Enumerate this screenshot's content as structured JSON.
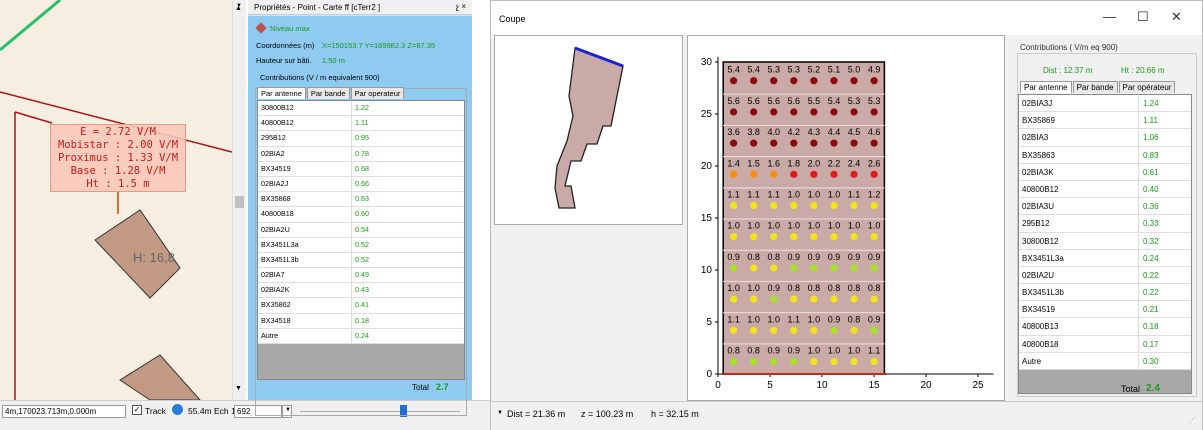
{
  "map": {
    "label_lines": [
      "E = 2.72 V/M",
      "Mobistar : 2.00 V/M",
      "Proximus : 1.33 V/M",
      "Base : 1.28 V/M",
      "Ht : 1.5 m"
    ],
    "building_label": "H: 16,8"
  },
  "map_status": {
    "coords": "4m,170023.713m,0.000m",
    "track_label": "Track",
    "scale_value": "55.4m",
    "ech_label": "Ech 1:",
    "ech_value": "692"
  },
  "props": {
    "title": "Propriétés - Point - Carte ff [cTerr2 ]",
    "pin": "չ ×",
    "niveau_label": "Niveau max",
    "coord_label": "Coordonnées (m)",
    "coord_value": "X=150153.7  Y=169982.3  Z=87.35",
    "hauteur_label": "Hauteur sur bâti.",
    "hauteur_value": "1.50 m",
    "group_title": "Contributions (V / m equivalent 900)",
    "tabs": [
      "Par antenne",
      "Par bande",
      "Par operateur"
    ],
    "rows": [
      {
        "name": "30800B12",
        "value": "1.22"
      },
      {
        "name": "40800B12",
        "value": "1.11"
      },
      {
        "name": "295B12",
        "value": "0.95"
      },
      {
        "name": "02BIA2",
        "value": "0.78"
      },
      {
        "name": "BX34519",
        "value": "0.68"
      },
      {
        "name": "02BIA2J",
        "value": "0.66"
      },
      {
        "name": "BX35868",
        "value": "0.63"
      },
      {
        "name": "40800B18",
        "value": "0.60"
      },
      {
        "name": "02BIA2U",
        "value": "0.54"
      },
      {
        "name": "BX3451L3a",
        "value": "0.52"
      },
      {
        "name": "BX3451L3b",
        "value": "0.52"
      },
      {
        "name": "02BIA7",
        "value": "0.49"
      },
      {
        "name": "02BIA2K",
        "value": "0.43"
      },
      {
        "name": "BX35862",
        "value": "0.41"
      },
      {
        "name": "BX34518",
        "value": "0.18"
      },
      {
        "name": "Autre",
        "value": "0.24"
      }
    ],
    "total_label": "Total",
    "total_value": "2.7"
  },
  "coupe": {
    "title": "Coupe",
    "min_icon": "—",
    "max_icon": "☐",
    "close_icon": "✕",
    "group_title": "Contributions ( V/m eq 900)",
    "dist_text": "Dist : 12.37 m",
    "ht_text": "Ht : 20.66 m",
    "tabs": [
      "Par antenne",
      "Par bande",
      "Par opérateur"
    ],
    "rows": [
      {
        "name": "02BIA3J",
        "value": "1.24"
      },
      {
        "name": "BX35869",
        "value": "1.11"
      },
      {
        "name": "02BIA3",
        "value": "1.06"
      },
      {
        "name": "BX35863",
        "value": "0.83"
      },
      {
        "name": "02BIA3K",
        "value": "0.61"
      },
      {
        "name": "40800B12",
        "value": "0.40"
      },
      {
        "name": "02BIA3U",
        "value": "0.36"
      },
      {
        "name": "295B12",
        "value": "0.33"
      },
      {
        "name": "30800B12",
        "value": "0.32"
      },
      {
        "name": "BX3451L3a",
        "value": "0.24"
      },
      {
        "name": "02BIA2U",
        "value": "0.22"
      },
      {
        "name": "BX3451L3b",
        "value": "0.22"
      },
      {
        "name": "BX34519",
        "value": "0.21"
      },
      {
        "name": "40800B13",
        "value": "0.18"
      },
      {
        "name": "40800B18",
        "value": "0.17"
      },
      {
        "name": "Autre",
        "value": "0.30"
      }
    ],
    "total_label": "Total",
    "total_value": "2.4",
    "status": {
      "dist": "Dist = 21.36 m",
      "z": "z = 100.23 m",
      "h": "h = 32.15 m"
    }
  },
  "section": {
    "x_ticks": [
      "0",
      "5",
      "10",
      "15",
      "20",
      "25"
    ],
    "y_ticks": [
      "0",
      "5",
      "10",
      "15",
      "20",
      "25",
      "30"
    ],
    "colors": {
      "dark_red": "#8b0a0a",
      "red": "#e01a1a",
      "orange": "#ff8c00",
      "yellow": "#f2e41a",
      "green": "#a8e02a",
      "wall": "#c9aaa6",
      "ground": "#c8281e"
    },
    "floors": [
      {
        "values": [
          "5.4",
          "5.4",
          "5.3",
          "5.3",
          "5.2",
          "5.1",
          "5.0",
          "4.9"
        ],
        "colors": [
          "dark_red",
          "dark_red",
          "dark_red",
          "dark_red",
          "dark_red",
          "dark_red",
          "dark_red",
          "dark_red"
        ]
      },
      {
        "values": [
          "5.6",
          "5.6",
          "5.6",
          "5.6",
          "5.5",
          "5.4",
          "5.3",
          "5.3"
        ],
        "colors": [
          "dark_red",
          "dark_red",
          "dark_red",
          "dark_red",
          "dark_red",
          "dark_red",
          "dark_red",
          "dark_red"
        ]
      },
      {
        "values": [
          "3.6",
          "3.8",
          "4.0",
          "4.2",
          "4.3",
          "4.4",
          "4.5",
          "4.6"
        ],
        "colors": [
          "dark_red",
          "dark_red",
          "dark_red",
          "dark_red",
          "dark_red",
          "dark_red",
          "dark_red",
          "dark_red"
        ]
      },
      {
        "values": [
          "1.4",
          "1.5",
          "1.6",
          "1.8",
          "2.0",
          "2.2",
          "2.4",
          "2.6"
        ],
        "colors": [
          "orange",
          "orange",
          "orange",
          "red",
          "red",
          "red",
          "red",
          "red"
        ]
      },
      {
        "values": [
          "1.1",
          "1.1",
          "1.1",
          "1.0",
          "1.0",
          "1.0",
          "1.1",
          "1.2"
        ],
        "colors": [
          "yellow",
          "yellow",
          "yellow",
          "yellow",
          "yellow",
          "yellow",
          "yellow",
          "yellow"
        ]
      },
      {
        "values": [
          "1.0",
          "1.0",
          "1.0",
          "1.0",
          "1.0",
          "1.0",
          "1.0",
          "1.0"
        ],
        "colors": [
          "yellow",
          "yellow",
          "yellow",
          "yellow",
          "yellow",
          "yellow",
          "yellow",
          "yellow"
        ]
      },
      {
        "values": [
          "0.9",
          "0.8",
          "0.8",
          "0.9",
          "0.9",
          "0.9",
          "0.9",
          "0.9"
        ],
        "colors": [
          "green",
          "yellow",
          "yellow",
          "green",
          "green",
          "green",
          "green",
          "green"
        ]
      },
      {
        "values": [
          "1.0",
          "1.0",
          "0.9",
          "0.8",
          "0.8",
          "0.8",
          "0.8",
          "0.8"
        ],
        "colors": [
          "yellow",
          "yellow",
          "green",
          "yellow",
          "yellow",
          "yellow",
          "yellow",
          "yellow"
        ]
      },
      {
        "values": [
          "1.1",
          "1.0",
          "1.0",
          "1.1",
          "1.0",
          "0.9",
          "0.8",
          "0.9"
        ],
        "colors": [
          "yellow",
          "yellow",
          "yellow",
          "yellow",
          "yellow",
          "green",
          "yellow",
          "green"
        ]
      },
      {
        "values": [
          "0.8",
          "0.8",
          "0.9",
          "0.9",
          "1.0",
          "1.0",
          "1.0",
          "1.1"
        ],
        "colors": [
          "green",
          "green",
          "green",
          "green",
          "yellow",
          "yellow",
          "yellow",
          "yellow"
        ]
      }
    ]
  }
}
